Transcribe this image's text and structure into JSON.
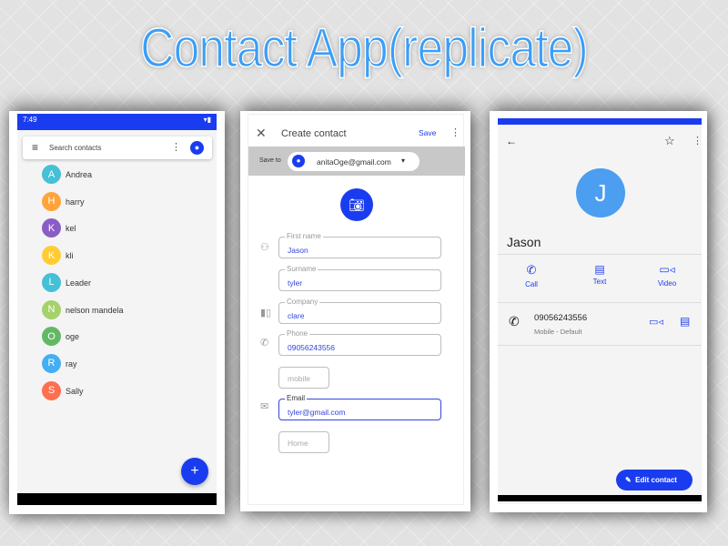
{
  "title": "Contact App(replicate)",
  "colors": {
    "primary": "#1a3cf0",
    "avatar_j": "#4b9ef0"
  },
  "list_screen": {
    "status_time": "7:49",
    "search_placeholder": "Search contacts",
    "contacts": [
      {
        "initial": "A",
        "name": "Andrea",
        "color": "#45c0d6"
      },
      {
        "initial": "H",
        "name": "harry",
        "color": "#ffa43a"
      },
      {
        "initial": "K",
        "name": "kel",
        "color": "#8a5cc6"
      },
      {
        "initial": "K",
        "name": "kli",
        "color": "#ffcc33"
      },
      {
        "initial": "L",
        "name": "Leader",
        "color": "#45c0d6"
      },
      {
        "initial": "N",
        "name": "nelson mandela",
        "color": "#a5d26a"
      },
      {
        "initial": "O",
        "name": "oge",
        "color": "#63b866"
      },
      {
        "initial": "R",
        "name": "ray",
        "color": "#44aef2"
      },
      {
        "initial": "S",
        "name": "Sally",
        "color": "#ff6f4f"
      }
    ],
    "fab_label": "+"
  },
  "create_screen": {
    "header": "Create contact",
    "save": "Save",
    "save_to_label": "Save to",
    "account": "anitaOge@gmail.com",
    "fields": {
      "first_name": {
        "label": "First name",
        "value": "Jason"
      },
      "surname": {
        "label": "Surname",
        "value": "tyler"
      },
      "company": {
        "label": "Company",
        "value": "clare"
      },
      "phone": {
        "label": "Phone",
        "value": "09056243556"
      },
      "phone_type": "mobile",
      "email": {
        "label": "Email",
        "value": "tyler@gmail.com"
      },
      "email_type": "Home"
    }
  },
  "detail_screen": {
    "initial": "J",
    "name": "Jason",
    "actions": {
      "call": "Call",
      "text": "Text",
      "video": "Video"
    },
    "phone": "09056243556",
    "phone_type": "Mobile - Default",
    "edit": "Edit contact"
  }
}
